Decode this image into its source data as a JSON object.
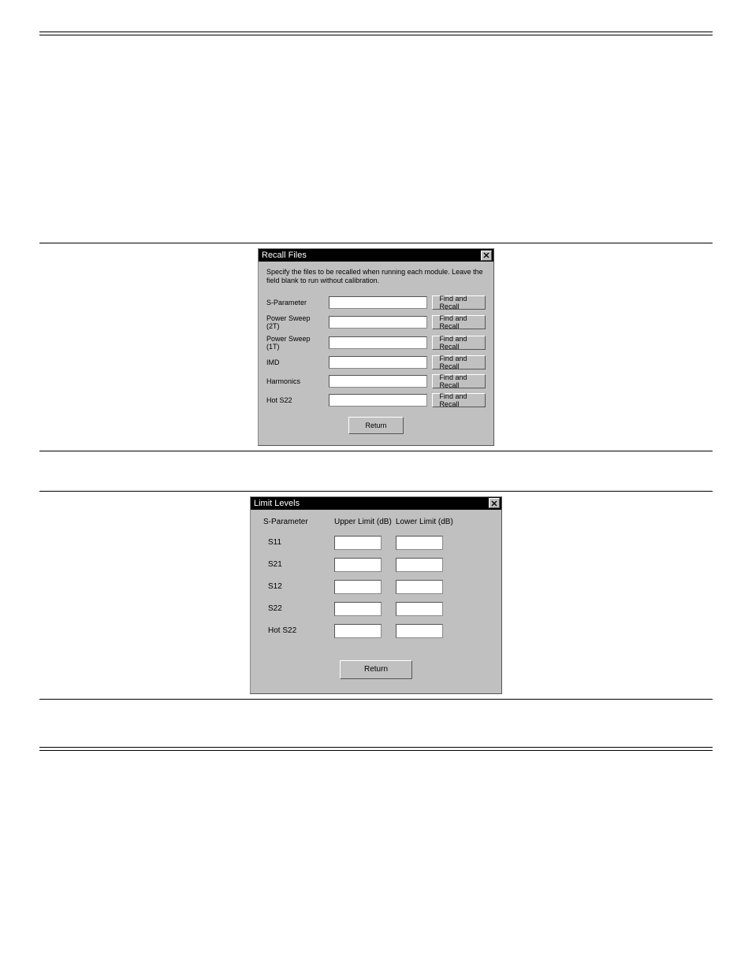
{
  "recall": {
    "title": "Recall Files",
    "instruction": "Specify the files to be recalled when running each module. Leave the field blank to run without calibration.",
    "rows": [
      {
        "label": "S-Parameter"
      },
      {
        "label": "Power Sweep (2T)"
      },
      {
        "label": "Power Sweep (1T)"
      },
      {
        "label": "IMD"
      },
      {
        "label": "Harmonics"
      },
      {
        "label": "Hot S22"
      }
    ],
    "find_recall": "Find and Recall",
    "return": "Return"
  },
  "limits": {
    "title": "Limit Levels",
    "left_heading": "S-Parameter",
    "upper": "Upper Limit (dB)",
    "lower": "Lower Limit (dB)",
    "rows": [
      {
        "label": "S11"
      },
      {
        "label": "S21"
      },
      {
        "label": "S12"
      },
      {
        "label": "S22"
      },
      {
        "label": "Hot S22"
      }
    ],
    "return": "Return"
  }
}
